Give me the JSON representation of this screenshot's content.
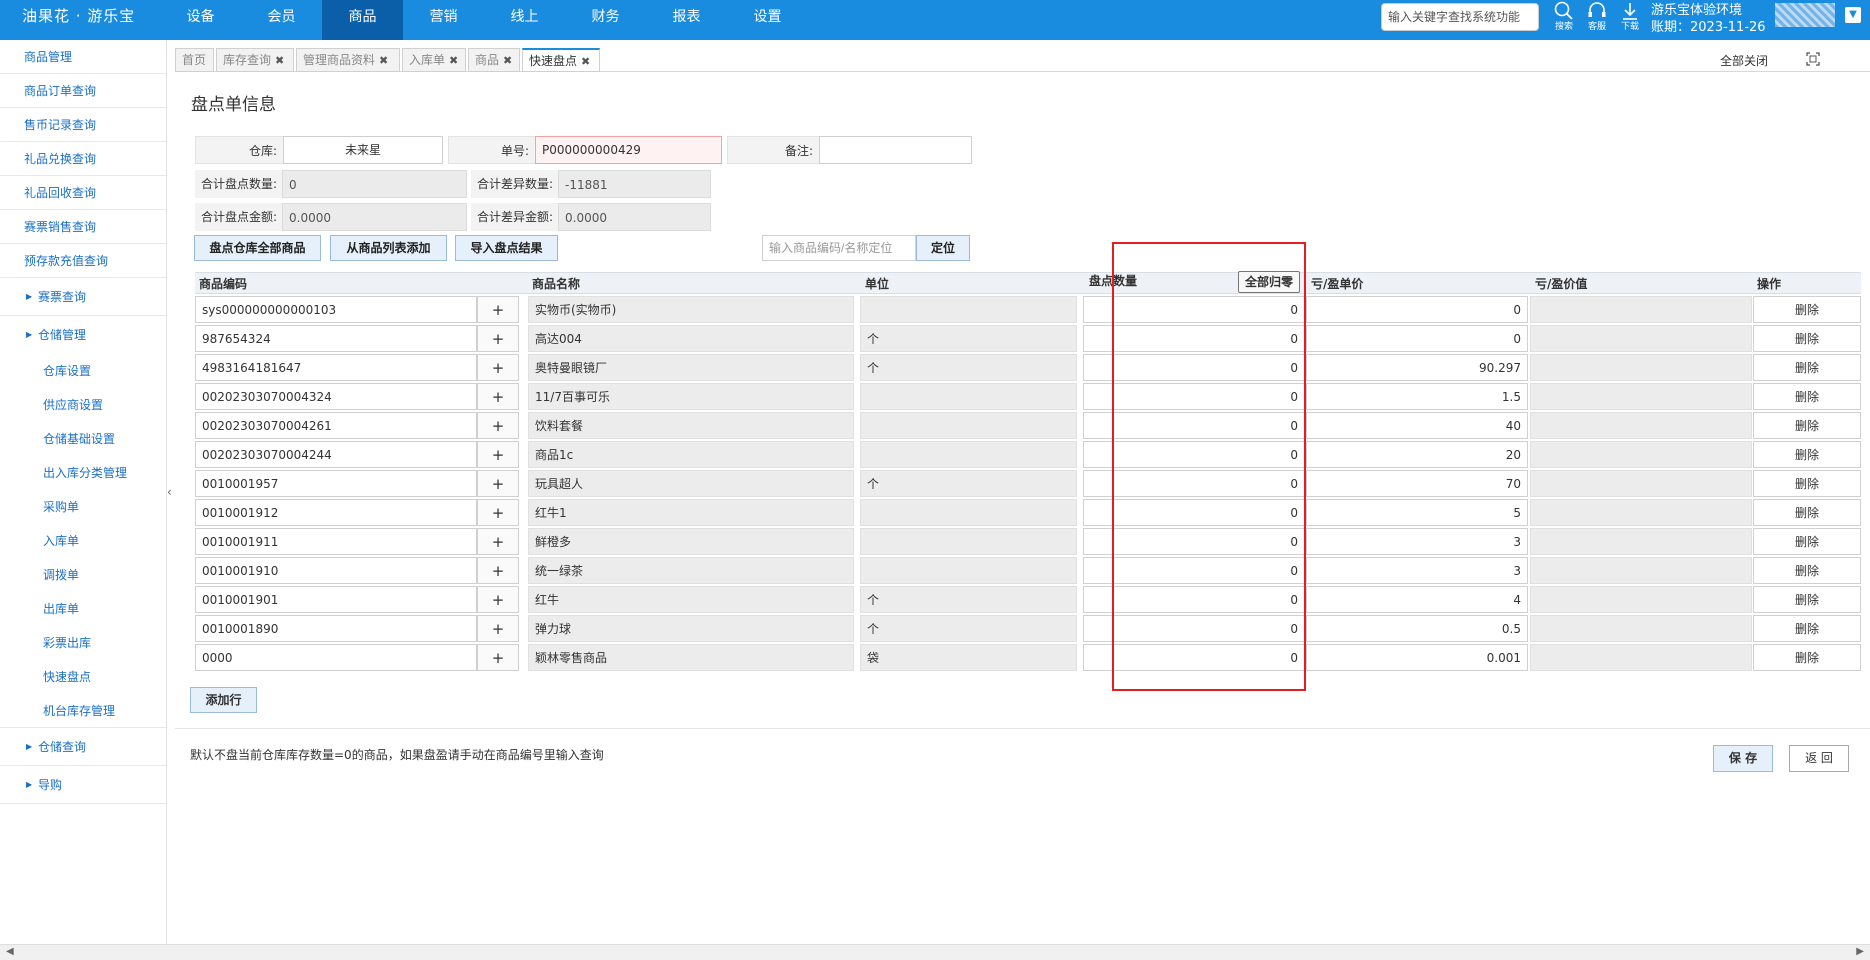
{
  "brand": "油果花 · 游乐宝",
  "topnav": [
    "设备",
    "会员",
    "商品",
    "营销",
    "线上",
    "财务",
    "报表",
    "设置"
  ],
  "top_search_placeholder": "输入关键字查找系统功能",
  "tools": {
    "search": "搜索",
    "service": "客服",
    "download": "下载"
  },
  "env": {
    "title": "游乐宝体验环境",
    "date": "账期：2023-11-26"
  },
  "sidebar": {
    "items": [
      "商品管理",
      "商品订单查询",
      "售币记录查询",
      "礼品兑换查询",
      "礼品回收查询",
      "赛票销售查询",
      "预存款充值查询"
    ],
    "group1": "赛票查询",
    "group2": "仓储管理",
    "sub": [
      "仓库设置",
      "供应商设置",
      "仓储基础设置",
      "出入库分类管理",
      "采购单",
      "入库单",
      "调拨单",
      "出库单",
      "彩票出库",
      "快速盘点",
      "机台库存管理"
    ],
    "group3": "仓储查询",
    "group4": "导购"
  },
  "tabs": [
    "首页",
    "库存查询",
    "管理商品资料",
    "入库单",
    "商品",
    "快速盘点"
  ],
  "close_all": "全部关闭",
  "page_title": "盘点单信息",
  "form": {
    "warehouse_label": "仓库:",
    "warehouse_value": "未来星",
    "order_label": "单号:",
    "order_value": "P000000000429",
    "remark_label": "备注:",
    "remark_value": ""
  },
  "summary": {
    "count_label": "合计盘点数量:",
    "count_value": "0",
    "diff_count_label": "合计差异数量:",
    "diff_count_value": "-11881",
    "amount_label": "合计盘点金额:",
    "amount_value": "0.0000",
    "diff_amount_label": "合计差异金额:",
    "diff_amount_value": "0.0000"
  },
  "buttons": {
    "all_goods": "盘点仓库全部商品",
    "from_list": "从商品列表添加",
    "import": "导入盘点结果",
    "locate_placeholder": "输入商品编码/名称定位",
    "locate": "定位",
    "zero_all": "全部归零",
    "add_row": "添加行",
    "save": "保 存",
    "back": "返 回"
  },
  "table": {
    "headers": [
      "商品编码",
      "商品名称",
      "单位",
      "盘点数量",
      "亏/盈单价",
      "亏/盈价值",
      "操作"
    ],
    "plus": "+",
    "delete": "删除",
    "rows": [
      {
        "code": "sys000000000000103",
        "name": "实物币(实物币)",
        "unit": "",
        "qty": "0",
        "price": "0",
        "value": ""
      },
      {
        "code": "987654324",
        "name": "高达004",
        "unit": "个",
        "qty": "0",
        "price": "0",
        "value": ""
      },
      {
        "code": "4983164181647",
        "name": "奥特曼眼镜厂",
        "unit": "个",
        "qty": "0",
        "price": "90.297",
        "value": ""
      },
      {
        "code": "00202303070004324",
        "name": "11/7百事可乐",
        "unit": "",
        "qty": "0",
        "price": "1.5",
        "value": ""
      },
      {
        "code": "00202303070004261",
        "name": "饮料套餐",
        "unit": "",
        "qty": "0",
        "price": "40",
        "value": ""
      },
      {
        "code": "00202303070004244",
        "name": "商品1c",
        "unit": "",
        "qty": "0",
        "price": "20",
        "value": ""
      },
      {
        "code": "0010001957",
        "name": "玩具超人",
        "unit": "个",
        "qty": "0",
        "price": "70",
        "value": ""
      },
      {
        "code": "0010001912",
        "name": "红牛1",
        "unit": "",
        "qty": "0",
        "price": "5",
        "value": ""
      },
      {
        "code": "0010001911",
        "name": "鲜橙多",
        "unit": "",
        "qty": "0",
        "price": "3",
        "value": ""
      },
      {
        "code": "0010001910",
        "name": "统一绿茶",
        "unit": "",
        "qty": "0",
        "price": "3",
        "value": ""
      },
      {
        "code": "0010001901",
        "name": "红牛",
        "unit": "个",
        "qty": "0",
        "price": "4",
        "value": ""
      },
      {
        "code": "0010001890",
        "name": "弹力球",
        "unit": "个",
        "qty": "0",
        "price": "0.5",
        "value": ""
      },
      {
        "code": "0000",
        "name": "颖林零售商品",
        "unit": "袋",
        "qty": "0",
        "price": "0.001",
        "value": ""
      }
    ]
  },
  "footnote": "默认不盘当前仓库库存数量=0的商品，如果盘盈请手动在商品编号里输入查询",
  "colors": {
    "topbar": "#1a8ce0",
    "active_nav": "#0a5fa8",
    "link": "#1a6fc4",
    "highlight_box": "#e02020"
  }
}
